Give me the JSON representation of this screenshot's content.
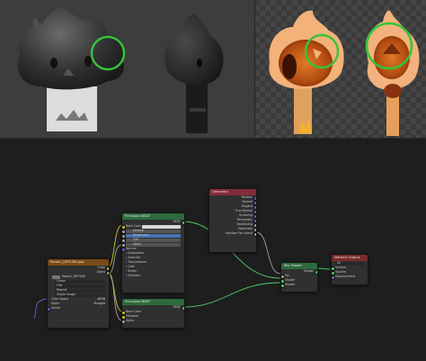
{
  "viewport": {
    "left_background": "#3d3d3d",
    "highlight_color": "#37c437"
  },
  "editor": {
    "background": "#1e1e1e",
    "nodes": {
      "geometry": {
        "title": "Geometry",
        "outputs": [
          "Position",
          "Normal",
          "Tangent",
          "True Normal",
          "Incoming",
          "Parametric",
          "Backfacing",
          "Pointiness",
          "Random Per Island"
        ]
      },
      "image_texture": {
        "title": "flame1_DIFFUSE.png",
        "outputs": [
          "Color",
          "Alpha"
        ],
        "image_name": "flame1_DIFFUSE",
        "settings": [
          {
            "label": "Linear"
          },
          {
            "label": "Flat"
          },
          {
            "label": "Repeat"
          },
          {
            "label": "Single Image"
          },
          {
            "label": "Color Space",
            "value": "sRGB"
          },
          {
            "label": "Alpha",
            "value": "Straight"
          }
        ],
        "input": "Vector"
      },
      "bsdf1": {
        "title": "Principled BSDF",
        "output": "BSDF",
        "inputs": [
          "Base Color",
          "Metallic",
          "Roughness",
          "IOR",
          "Alpha",
          "Normal",
          "Subsurface",
          "Specular",
          "Transmission",
          "Coat",
          "Sheen",
          "Emission"
        ]
      },
      "bsdf2": {
        "title": "Principled BSDF",
        "output": "BSDF",
        "inputs": [
          "Base Color",
          "Emission",
          "Alpha"
        ]
      },
      "mix": {
        "title": "Mix Shader",
        "output": "Shader",
        "inputs": [
          "Fac",
          "Shader",
          "Shader"
        ]
      },
      "output": {
        "title": "Material Output",
        "target": "All",
        "inputs": [
          "Surface",
          "Volume",
          "Displacement"
        ]
      }
    }
  }
}
